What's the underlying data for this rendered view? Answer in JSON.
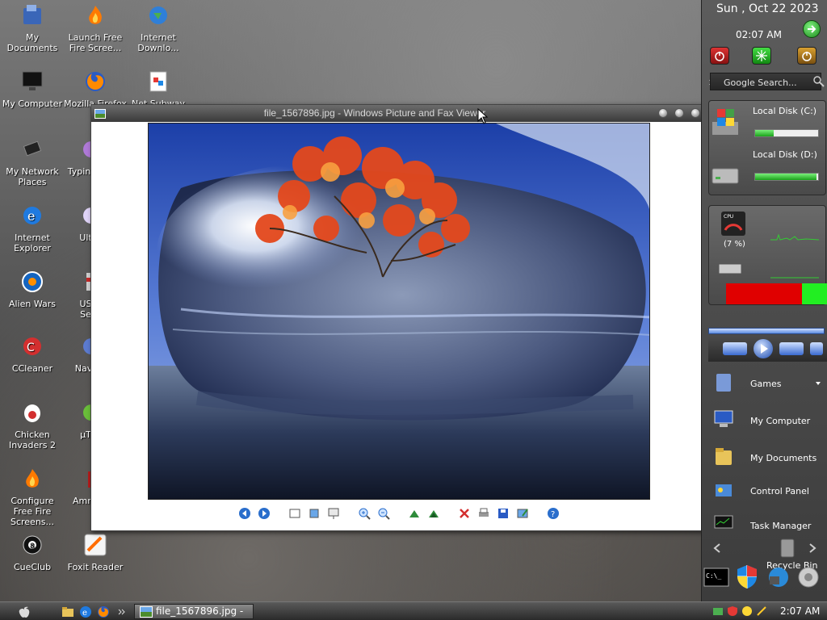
{
  "desktop": {
    "icons": [
      {
        "label": "My Documents"
      },
      {
        "label": "Launch Free Fire Scree..."
      },
      {
        "label": "Internet Downlo..."
      },
      {
        "label": "My Computer"
      },
      {
        "label": "Mozilla Firefox"
      },
      {
        "label": "Net Subway"
      },
      {
        "label": "My Network Places"
      },
      {
        "label": "Typin"
      },
      {
        "label": "Internet Explorer"
      },
      {
        "label": "Ult"
      },
      {
        "label": "Alien Wars"
      },
      {
        "label": "US Se"
      },
      {
        "label": "CCleaner"
      },
      {
        "label": "Navi"
      },
      {
        "label": "Chicken Invaders 2"
      },
      {
        "label": "µT"
      },
      {
        "label": "Configure Free Fire Screens..."
      },
      {
        "label": "Ammy"
      },
      {
        "label": "CueClub"
      },
      {
        "label": "Foxit Reader"
      }
    ]
  },
  "viewer": {
    "title": "file_1567896.jpg - Windows Picture and Fax Viewer"
  },
  "sidebar": {
    "date": "Sun , Oct 22 2023",
    "time": "02:07 AM",
    "search_placeholder": "Google Search...",
    "disks": [
      {
        "label": "Local Disk (C:)",
        "used_fraction": 0.3
      },
      {
        "label": "Local Disk (D:)",
        "used_fraction": 0.98
      }
    ],
    "cpu": {
      "label": "CPU",
      "value": "(7 %)"
    },
    "menu": [
      {
        "label": "Games"
      },
      {
        "label": "My Computer"
      },
      {
        "label": "My Documents"
      },
      {
        "label": "Control Panel"
      },
      {
        "label": "Task Manager"
      },
      {
        "label": "Recycle Bin"
      }
    ]
  },
  "taskbar": {
    "task_title": "file_1567896.jpg - ...",
    "clock": "2:07 AM"
  },
  "colors": {
    "accent_green": "#1aa11a",
    "memory_red": "#e00000",
    "memory_green": "#22ee22"
  }
}
